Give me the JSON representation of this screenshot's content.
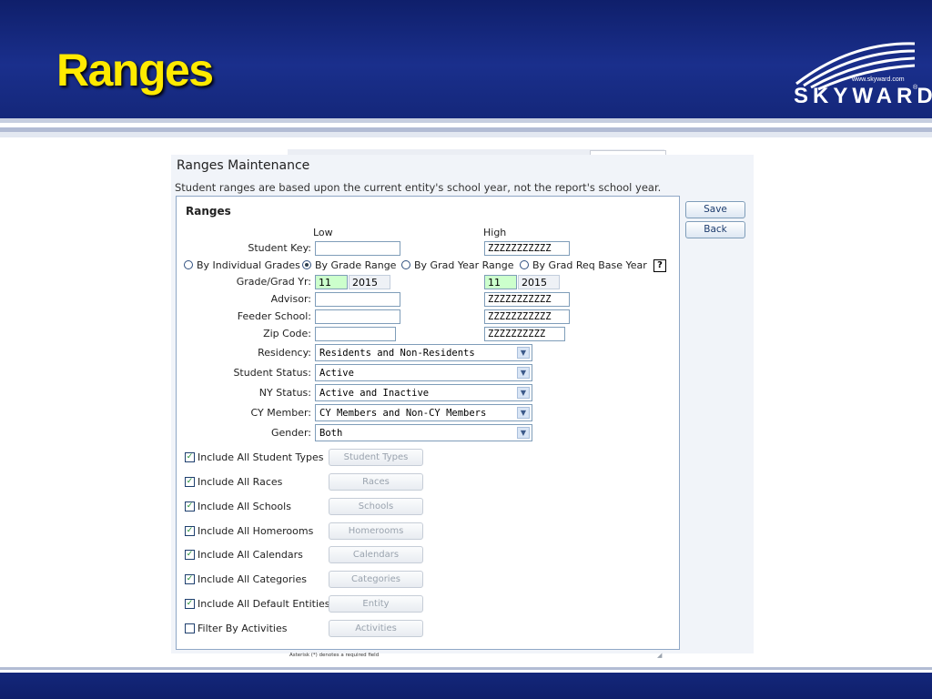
{
  "slide": {
    "title": "Ranges",
    "logo_text": "SKYWARD",
    "logo_url": "www.skyward.com",
    "logo_reg": "®"
  },
  "screen": {
    "title": "Ranges Maintenance",
    "description": "Student ranges are based upon the current entity's school year, not the report's school year.",
    "panel_title": "Ranges",
    "col_low": "Low",
    "col_high": "High",
    "fields": {
      "student_key": {
        "label": "Student Key:",
        "low": "",
        "high": "ZZZZZZZZZZZ"
      },
      "grade": {
        "label": "Grade/Grad Yr:",
        "low_grade": "11",
        "low_year": "2015",
        "high_grade": "11",
        "high_year": "2015"
      },
      "advisor": {
        "label": "Advisor:",
        "low": "",
        "high": "ZZZZZZZZZZZ"
      },
      "feeder_school": {
        "label": "Feeder School:",
        "low": "",
        "high": "ZZZZZZZZZZZ"
      },
      "zip_code": {
        "label": "Zip Code:",
        "low": "",
        "high": "ZZZZZZZZZZ"
      }
    },
    "radios": {
      "by_individual_grades": "By Individual Grades",
      "by_grade_range": "By Grade Range",
      "by_grad_year_range": "By Grad Year Range",
      "by_grad_req_base_year": "By Grad Req Base Year",
      "selected": "By Grade Range"
    },
    "help_label": "?",
    "selects": {
      "residency": {
        "label": "Residency:",
        "value": "Residents and Non-Residents"
      },
      "student_status": {
        "label": "Student Status:",
        "value": "Active"
      },
      "ny_status": {
        "label": "NY Status:",
        "value": "Active and Inactive"
      },
      "cy_member": {
        "label": "CY Member:",
        "value": "CY Members and Non-CY Members"
      },
      "gender": {
        "label": "Gender:",
        "value": "Both"
      }
    },
    "checks": {
      "student_types": {
        "label": "Include All Student Types",
        "checked": true,
        "button": "Student Types"
      },
      "races": {
        "label": "Include All Races",
        "checked": true,
        "button": "Races"
      },
      "schools": {
        "label": "Include All Schools",
        "checked": true,
        "button": "Schools"
      },
      "homerooms": {
        "label": "Include All Homerooms",
        "checked": true,
        "button": "Homerooms"
      },
      "calendars": {
        "label": "Include All Calendars",
        "checked": true,
        "button": "Calendars"
      },
      "categories": {
        "label": "Include All Categories",
        "checked": true,
        "button": "Categories"
      },
      "default_entities": {
        "label": "Include All Default Entities",
        "checked": true,
        "button": "Entity"
      },
      "activities": {
        "label": "Filter By Activities",
        "checked": false,
        "button": "Activities"
      }
    },
    "check_mark": "✓",
    "buttons": {
      "save": "Save",
      "back": "Back"
    },
    "footnote": "Asterisk (*) denotes a required field",
    "colors": {
      "header_blue": "#1a2f8c",
      "title_yellow": "#ffea00",
      "panel_border": "#8fa7c6",
      "field_green": "#ccffcc"
    }
  }
}
